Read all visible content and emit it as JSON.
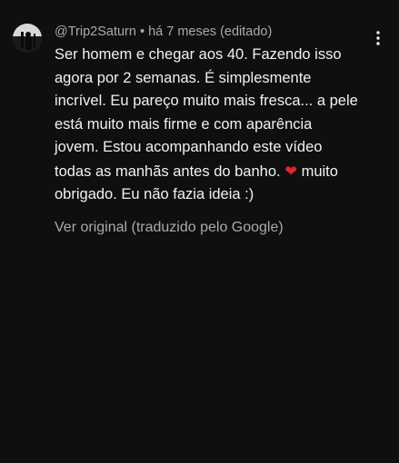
{
  "comment": {
    "author": "@Trip2Saturn",
    "separator": "•",
    "time": "há 7 meses (editado)",
    "body_lines": [
      "Ser homem e chegar aos 40. Fazendo isso",
      "agora por 2 semanas. É simplesmente",
      "incrível. Eu pareço muito mais fresca... a pele",
      "está muito mais firme e com aparência",
      "jovem. Estou acompanhando este vídeo",
      "todas as manhãs antes do banho. ",
      " muito",
      "obrigado. Eu não fazia ideia :)"
    ],
    "heart_emoji": "❤",
    "translation_link": "Ver original (traduzido pelo Google)"
  },
  "icons": {
    "more": "more-vert-icon",
    "avatar": "avatar-image"
  },
  "colors": {
    "background": "#0f0f0f",
    "text_primary": "#f1f1f1",
    "text_secondary": "#aaaaaa",
    "heart": "#e0242a"
  }
}
